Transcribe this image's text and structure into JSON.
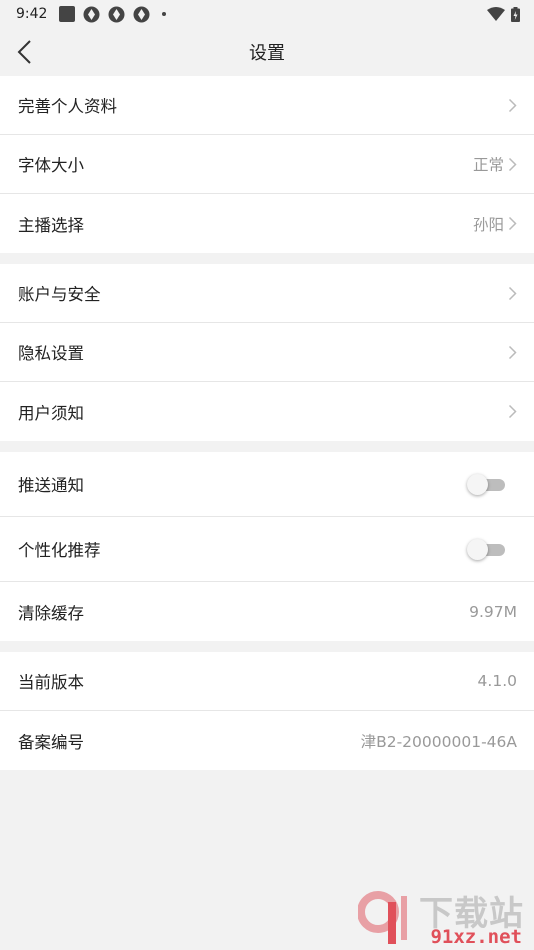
{
  "status_bar": {
    "time": "9:42"
  },
  "header": {
    "title": "设置"
  },
  "groups": [
    {
      "items": [
        {
          "label": "完善个人资料",
          "value": ""
        },
        {
          "label": "字体大小",
          "value": "正常"
        },
        {
          "label": "主播选择",
          "value": "孙阳"
        }
      ]
    },
    {
      "items": [
        {
          "label": "账户与安全",
          "value": ""
        },
        {
          "label": "隐私设置",
          "value": ""
        },
        {
          "label": "用户须知",
          "value": ""
        }
      ]
    },
    {
      "items": [
        {
          "label": "推送通知",
          "toggle": false
        },
        {
          "label": "个性化推荐",
          "toggle": false
        },
        {
          "label": "清除缓存",
          "value": "9.97M"
        }
      ]
    },
    {
      "items": [
        {
          "label": "当前版本",
          "value": "4.1.0"
        },
        {
          "label": "备案编号",
          "value": "津B2-20000001-46A"
        }
      ]
    }
  ],
  "watermark": {
    "brand": "下载站",
    "site": "91xz.net"
  },
  "colors": {
    "background": "#f2f2f2",
    "row_text": "#222222",
    "value_text": "#999999",
    "watermark_red": "#e0505a"
  }
}
